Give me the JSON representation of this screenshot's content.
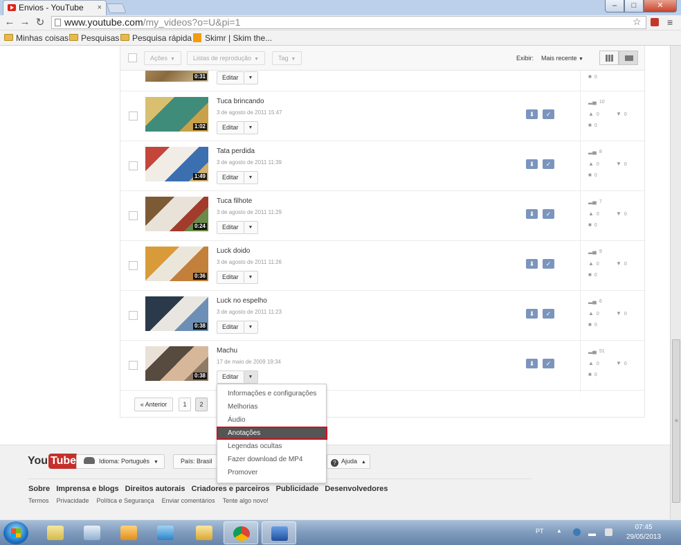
{
  "browser": {
    "tab_title": "Envios - YouTube",
    "tab_close": "×",
    "url_host": "www.youtube.com",
    "url_path": "/my_videos?o=U&pi=1",
    "win_min": "‒",
    "win_max": "□",
    "win_close": "✕",
    "bookmarks": [
      "Minhas coisas",
      "Pesquisas",
      "Pesquisa rápida",
      "Skimr | Skim the..."
    ]
  },
  "toolbar": {
    "actions": "Ações",
    "playlists": "Listas de reprodução",
    "tag": "Tag",
    "view_label": "Exibir:",
    "sort": "Mais recente"
  },
  "videos": [
    {
      "title": "Tuca brincando",
      "date": "3 de agosto de 2011 15:47",
      "duration": "1:02",
      "views": "10",
      "likes": "0",
      "dislikes": "0",
      "comments": "0"
    },
    {
      "title": "Tata perdida",
      "date": "3 de agosto de 2011 11:39",
      "duration": "1:49",
      "views": "8",
      "likes": "0",
      "dislikes": "0",
      "comments": "0"
    },
    {
      "title": "Tuca filhote",
      "date": "3 de agosto de 2011 11:29",
      "duration": "0:24",
      "views": "7",
      "likes": "0",
      "dislikes": "0",
      "comments": "0"
    },
    {
      "title": "Luck doido",
      "date": "3 de agosto de 2011 11:26",
      "duration": "0:36",
      "views": "9",
      "likes": "0",
      "dislikes": "0",
      "comments": "0"
    },
    {
      "title": "Luck no espelho",
      "date": "3 de agosto de 2011 11:23",
      "duration": "0:38",
      "views": "6",
      "likes": "0",
      "dislikes": "0",
      "comments": "0"
    },
    {
      "title": "Machu",
      "date": "17 de maio de 2009 19:34",
      "duration": "0:38",
      "views": "51",
      "likes": "0",
      "dislikes": "0",
      "comments": "0"
    }
  ],
  "partial_row": {
    "duration": "0:31",
    "comments": "0"
  },
  "edit_label": "Editar",
  "pagination": {
    "prev": "« Anterior",
    "pages": [
      "1",
      "2"
    ]
  },
  "edit_menu": [
    "Informações e configurações",
    "Melhorias",
    "Áudio",
    "Anotações",
    "Legendas ocultas",
    "Fazer download de MP4",
    "Promover"
  ],
  "footer": {
    "logo_you": "You",
    "logo_tube": "Tube",
    "language": "Idioma: Português",
    "country": "País: Brasil",
    "help": "Ajuda",
    "links": [
      "Sobre",
      "Imprensa e blogs",
      "Direitos autorais",
      "Criadores e parceiros",
      "Publicidade",
      "Desenvolvedores"
    ],
    "small_links": [
      "Termos",
      "Privacidade",
      "Política e Segurança",
      "Enviar comentários",
      "Tente algo novo!"
    ]
  },
  "taskbar": {
    "lang": "PT",
    "time": "07:45",
    "date": "29/05/2013"
  },
  "colors": {
    "highlight_border": "#d0101b",
    "youtube_red": "#c4302b",
    "action_blue": "#7b95bd"
  }
}
